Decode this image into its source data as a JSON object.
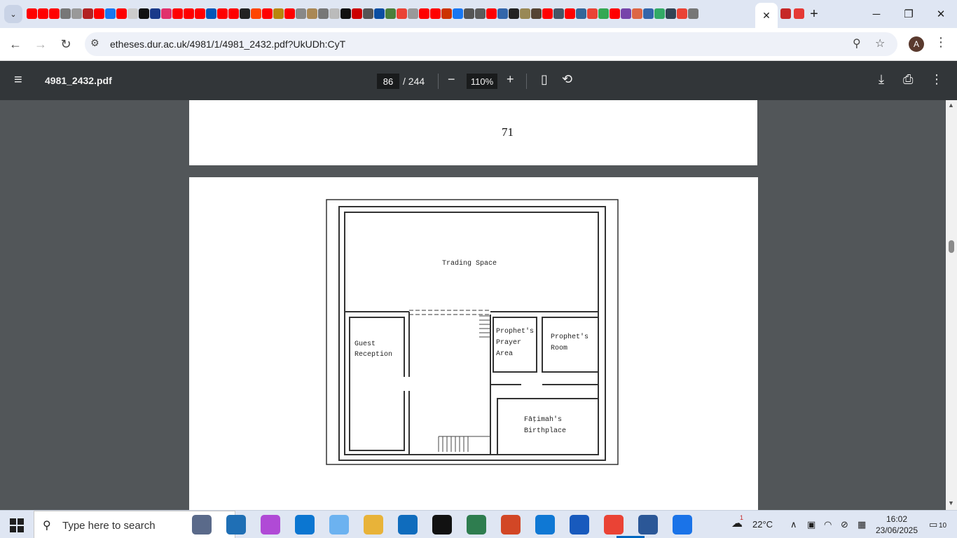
{
  "browser": {
    "tab_search_glyph": "⌄",
    "active_tab_close_glyph": "✕",
    "new_tab_glyph": "+",
    "favicon_colors": [
      "#ff0000",
      "#ff0000",
      "#ff0000",
      "#777777",
      "#999999",
      "#b22222",
      "#ff0000",
      "#1877f2",
      "#ff0000",
      "#cccccc",
      "#111111",
      "#1a3a8a",
      "#e1306c",
      "#ff0000",
      "#ff0000",
      "#ff0000",
      "#0057b8",
      "#ff0000",
      "#ff0000",
      "#222222",
      "#ff4500",
      "#ff0000",
      "#b8860b",
      "#ff0000",
      "#888888",
      "#aa8855",
      "#777777",
      "#bbbbbb",
      "#111111",
      "#cc0000",
      "#555555",
      "#0b4ea2",
      "#4a7f3b",
      "#ea4335",
      "#999999",
      "#ff0000",
      "#ff0000",
      "#cc3300",
      "#1877f2",
      "#555555",
      "#5b5b5b",
      "#ff0000",
      "#3366aa",
      "#222222",
      "#998855",
      "#554433",
      "#ff0000",
      "#445566",
      "#ff0000",
      "#336699",
      "#ea4335",
      "#34a853",
      "#ff0000",
      "#7744aa",
      "#dd6644",
      "#3366aa",
      "#33aa66",
      "#334455",
      "#ea4335",
      "#777777"
    ],
    "window_controls": {
      "minimize": "─",
      "maximize": "❐",
      "close": "✕"
    }
  },
  "toolbar": {
    "back_glyph": "←",
    "forward_glyph": "→",
    "reload_glyph": "↻",
    "site_info_glyph": "⚙",
    "url": "etheses.dur.ac.uk/4981/1/4981_2432.pdf?UkUDh:CyT",
    "zoom_glyph": "⚲",
    "bookmark_glyph": "☆",
    "avatar_letter": "A",
    "menu_glyph": "⋮"
  },
  "pdf": {
    "menu_glyph": "≡",
    "filename": "4981_2432.pdf",
    "current_page": "86",
    "total_pages": "/ 244",
    "zoom_out_glyph": "−",
    "zoom": "110%",
    "zoom_in_glyph": "+",
    "fit_glyph": "▯",
    "rotate_glyph": "⟲",
    "download_glyph": "⤓",
    "print_glyph": "⎙",
    "more_glyph": "⋮",
    "previous_page_number": "71",
    "floor_plan": {
      "trading_space": "Trading Space",
      "guest_reception": [
        "Guest",
        "Reception"
      ],
      "prophets_prayer_area": [
        "Prophet's",
        "Prayer",
        "Area"
      ],
      "prophets_room": [
        "Prophet's",
        "Room"
      ],
      "fatimahs_birthplace": [
        "Fāṭimah's",
        "Birthplace"
      ]
    }
  },
  "taskbar": {
    "search_placeholder": "Type here to search",
    "app_colors": [
      "#5a6a8a",
      "#1f6fb5",
      "#b04ad6",
      "#0b76d1",
      "#6cb2f0",
      "#e8b339",
      "#0f6cbd",
      "#111111",
      "#2e7d4f",
      "#d24726",
      "#0f78d4",
      "#185abd",
      "#ea4335",
      "#2b5797",
      "#1a73e8"
    ],
    "weather": "22°C",
    "weather_badge": "1",
    "tray_chevron": "∧",
    "time": "16:02",
    "date": "23/06/2025",
    "notification_count": "10"
  }
}
